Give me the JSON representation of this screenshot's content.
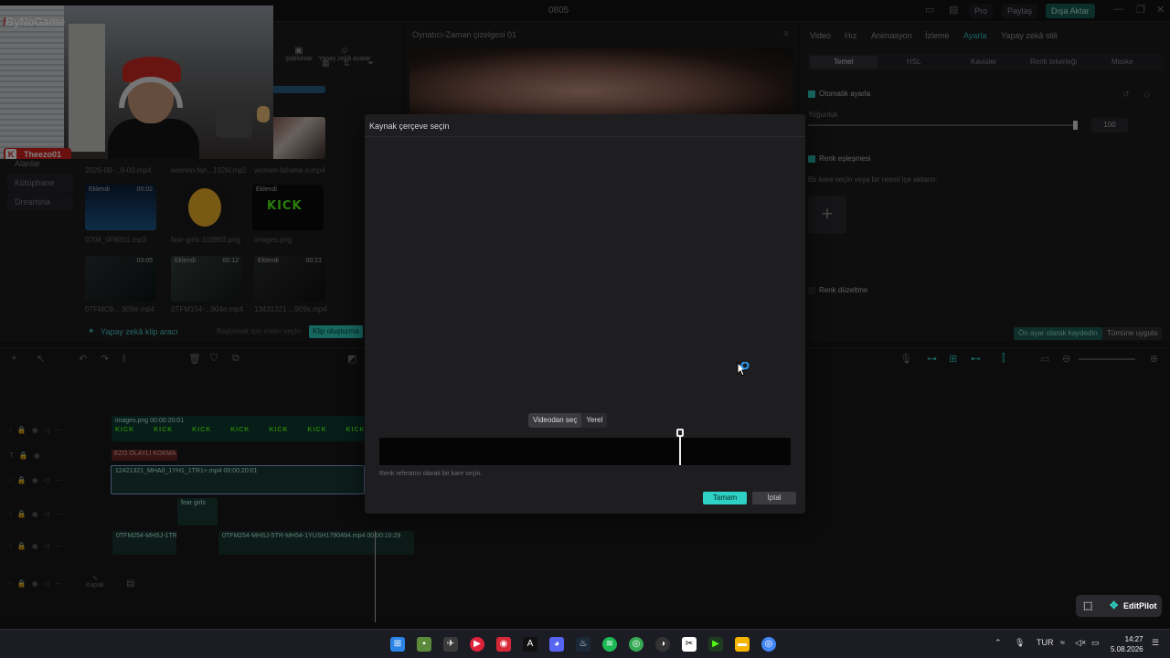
{
  "window": {
    "title": "0805",
    "pro_label": "Pro",
    "share_label": "Paylaş",
    "export_label": "Dışa Aktar"
  },
  "media_panel": {
    "tabs": [
      "Şablonlar",
      "Yapay zekâ avatar"
    ],
    "nav": [
      "Alanlar",
      "Kütüphane",
      "Dreamina"
    ],
    "thumbs": [
      {
        "caption": "2026-08-...8-00.mp4",
        "tag": "",
        "duration": ""
      },
      {
        "caption": "women-fah...192kl.mp3",
        "tag": "",
        "duration": ""
      },
      {
        "caption": "women-fahaha-o.mp4",
        "tag": "",
        "duration": ""
      },
      {
        "caption": "0708_0F8001.mp3",
        "tag": "Eklendi",
        "duration": "00:02"
      },
      {
        "caption": "fear-girls-102893.png",
        "tag": "",
        "duration": ""
      },
      {
        "caption": "images.png",
        "tag": "Eklendi",
        "duration": "",
        "text": "KICK"
      },
      {
        "caption": "0TFMC8-...909#.mp4",
        "tag": "",
        "duration": "03:05"
      },
      {
        "caption": "0TFM154-...904e.mp4",
        "tag": "Eklendi",
        "duration": "00:12"
      },
      {
        "caption": "13431321 ...909s.mp4",
        "tag": "Eklendi",
        "duration": "00:21"
      }
    ],
    "ai_tool_label": "Yapay zekâ klip aracı",
    "ai_placeholder": "Başlamak için metin seçin",
    "ai_button": "Klip oluşturma"
  },
  "player": {
    "title": "Oynatıcı-Zaman çizelgesi 01"
  },
  "inspector": {
    "tabs": [
      "Video",
      "Hız",
      "Animasyon",
      "İzleme",
      "Ayarla",
      "Yapay zekâ stili"
    ],
    "active_tab": "Ayarla",
    "subtabs": [
      "Temel",
      "HSL",
      "Kavisler",
      "Renk tekerleği",
      "Maske"
    ],
    "auto_adjust": "Otomatik ayarla",
    "intensity_label": "Yoğunluk",
    "intensity_value": "100",
    "color_match": "Renk eşleşmesi",
    "color_match_hint": "Bir kare seçin veya bir resmi içe aktarın.",
    "color_correction": "Renk düzeltme",
    "save_preset": "Ön ayar olarak kaydedin",
    "apply_all": "Tümüne uygula"
  },
  "timeline": {
    "clips": [
      {
        "label": "images.png  00:00:20:01",
        "kind": "kick"
      },
      {
        "label": "EZO OLAYLI KOKMA",
        "kind": "text"
      },
      {
        "label": "12421321_MHA0_1YH1_1TR1+.mp4  00:00:20:01",
        "kind": "video"
      },
      {
        "label": "fear girls",
        "kind": "sticker"
      },
      {
        "label": "0TFM254-MHSJ-1TR1",
        "kind": "video2"
      },
      {
        "label": "0TFM254-MHSJ-5TR-MH54-1YUSH1790494.mp4  00:00:10:29",
        "kind": "video2"
      }
    ],
    "kick_text": "KICK",
    "cover_label": "Kapak"
  },
  "webcam": {
    "brand": "ByNoGame",
    "username": "Theezo01"
  },
  "modal": {
    "title": "Kaynak çerçeve seçin",
    "source_options": [
      "Videodan seç",
      "Yerel"
    ],
    "selected_source": "Videodan seç",
    "hint": "Renk referansı olarak bir kare seçin.",
    "ok_label": "Tamam",
    "cancel_label": "İptal"
  },
  "editpilot": {
    "label": "EditPilot"
  },
  "taskbar": {
    "language": "TUR",
    "time": "14:27",
    "date": "5.08.2026"
  },
  "colors": {
    "accent": "#2ed1c3",
    "kick_green": "#53fc18",
    "badge_red": "#d4211c"
  }
}
